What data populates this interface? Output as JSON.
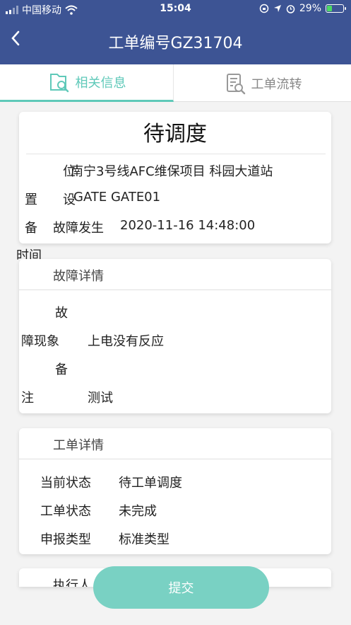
{
  "status_bar": {
    "carrier": "中国移动",
    "time": "15:04",
    "battery": "29%"
  },
  "header": {
    "title": "工单编号GZ31704"
  },
  "tabs": [
    {
      "label": "相关信息",
      "active": true
    },
    {
      "label": "工单流转",
      "active": false
    }
  ],
  "summary": {
    "status": "待调度",
    "location_label_1": "位",
    "location_label_2": "置",
    "location_value": "南宁3号线AFC维保项目   科园大道站",
    "device_label_1": "设",
    "device_label_2": "备",
    "device_value": "GATE   GATE01",
    "time_label_1": "故障发生",
    "time_label_2": "时间",
    "time_value": "2020-11-16 14:48:00"
  },
  "fault_detail": {
    "header": "故障详情",
    "symptom_label_1": "故",
    "symptom_label_2": "障现象",
    "symptom_value": "上电没有反应",
    "remark_label_1": "备",
    "remark_label_2": "注",
    "remark_value": "测试"
  },
  "order_detail": {
    "header": "工单详情",
    "rows": [
      {
        "label": "当前状态",
        "value": "待工单调度"
      },
      {
        "label": "工单状态",
        "value": "未完成"
      },
      {
        "label": "申报类型",
        "value": "标准类型"
      }
    ]
  },
  "executor": {
    "header": "执行人"
  },
  "submit": {
    "label": "提交"
  },
  "colors": {
    "header_bg": "#3d5494",
    "accent": "#5fc9b9",
    "submit_bg": "#79d1c3"
  }
}
